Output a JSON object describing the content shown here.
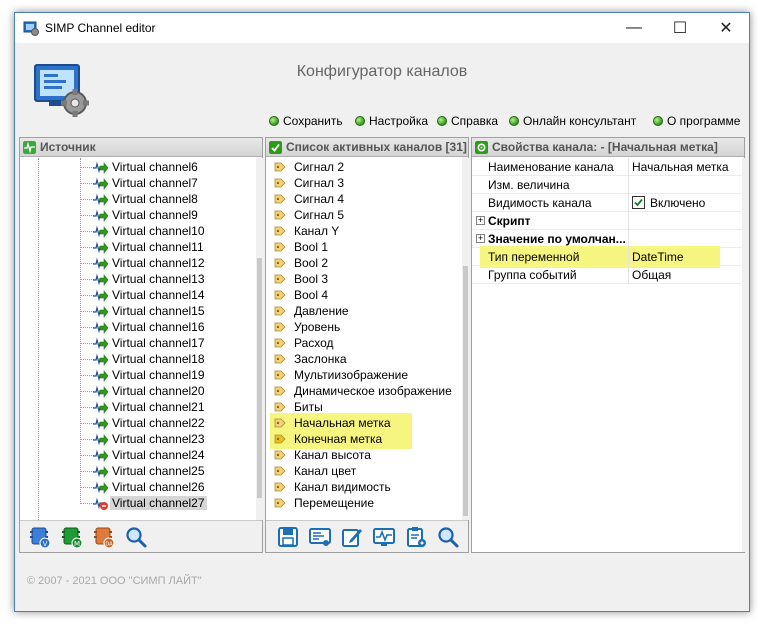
{
  "window": {
    "title": "SIMP Channel editor",
    "minimize": "—",
    "maximize": "☐",
    "close": "✕"
  },
  "header": {
    "title": "Конфигуратор каналов"
  },
  "menu": [
    {
      "label": "Сохранить"
    },
    {
      "label": "Настройка"
    },
    {
      "label": "Справка"
    },
    {
      "label": "Онлайн консультант"
    },
    {
      "label": "О программе"
    }
  ],
  "source_panel": {
    "title": "Источник",
    "items": [
      "Virtual channel6",
      "Virtual channel7",
      "Virtual channel8",
      "Virtual channel9",
      "Virtual channel10",
      "Virtual channel11",
      "Virtual channel12",
      "Virtual channel13",
      "Virtual channel14",
      "Virtual channel15",
      "Virtual channel16",
      "Virtual channel17",
      "Virtual channel18",
      "Virtual channel19",
      "Virtual channel20",
      "Virtual channel21",
      "Virtual channel22",
      "Virtual channel23",
      "Virtual channel24",
      "Virtual channel25",
      "Virtual channel26",
      "Virtual channel27"
    ],
    "selected": "Virtual channel27"
  },
  "active_panel": {
    "title": "Список активных каналов [31]",
    "items": [
      "Сигнал 2",
      "Сигнал 3",
      "Сигнал 4",
      "Сигнал 5",
      "Канал Y",
      "Bool 1",
      "Bool 2",
      "Bool 3",
      "Bool 4",
      "Давление",
      "Уровень",
      "Расход",
      "Заслонка",
      "Мультиизображение",
      "Динамическое изображение",
      "Биты",
      "Начальная метка",
      "Конечная метка",
      "Канал высота",
      "Канал цвет",
      "Канал видимость",
      "Перемещение"
    ],
    "highlighted": [
      "Начальная метка",
      "Конечная метка"
    ]
  },
  "props_panel": {
    "title": "Свойства канала: - [Начальная метка]",
    "rows": [
      {
        "name": "Наименование канала",
        "value": "Начальная метка"
      },
      {
        "name": "Изм. величина",
        "value": ""
      },
      {
        "name": "Видимость канала",
        "value": "Включено",
        "checked": true
      },
      {
        "name": "Скрипт",
        "value": "",
        "group": true
      },
      {
        "name": "Значение по умолчан...",
        "value": "",
        "group": true
      },
      {
        "name": "Тип переменной",
        "value": "DateTime",
        "highlighted": true
      },
      {
        "name": "Группа событий",
        "value": "Общая"
      }
    ]
  },
  "footer": {
    "copyright": "© 2007 - 2021  ООО \"СИМП ЛАЙТ\""
  },
  "colors": {
    "accent_green": "#2e9b1c",
    "highlight_yellow": "#f5f36a",
    "window_border": "#4a7fb8"
  }
}
